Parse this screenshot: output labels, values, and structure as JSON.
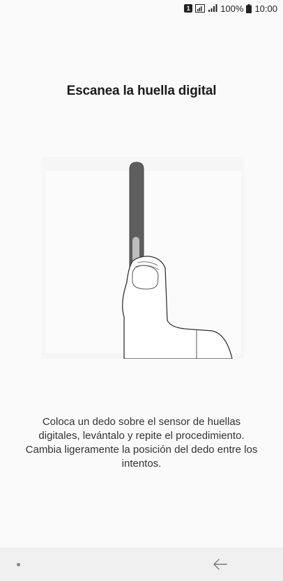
{
  "status_bar": {
    "sim_slot": "1",
    "battery_percent": "100%",
    "time": "10:00"
  },
  "title": "Escanea la huella digital",
  "instruction": "Coloca un dedo sobre el sensor de huellas digitales, levántalo y repite el procedimiento. Cambia ligeramente la posición del dedo entre los intentos.",
  "icons": {
    "signal": "signal-bars-icon",
    "battery": "battery-icon",
    "back": "back-arrow-icon",
    "illustration": "finger-on-sensor-illustration"
  }
}
